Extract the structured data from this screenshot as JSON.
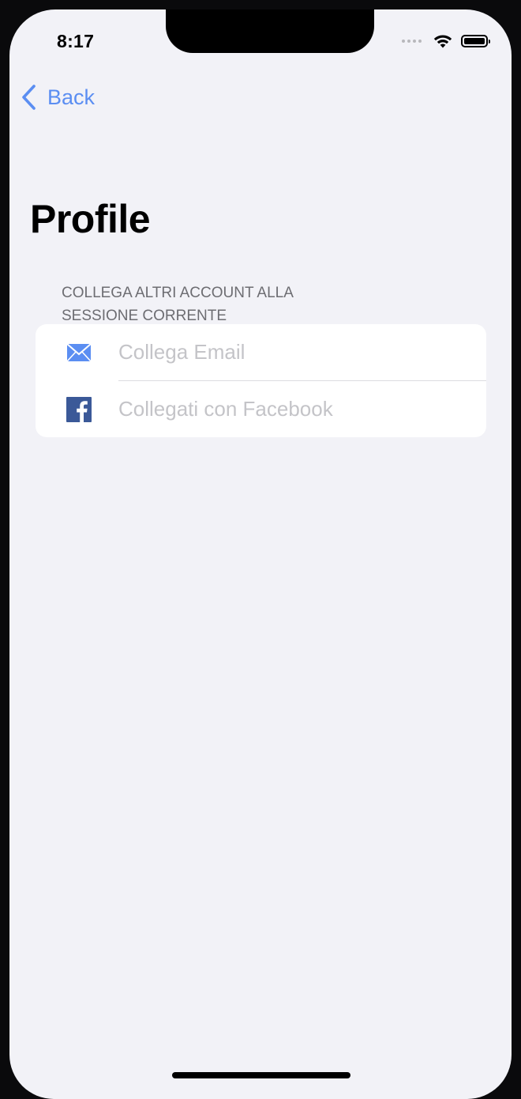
{
  "status_bar": {
    "time": "8:17"
  },
  "nav": {
    "back_label": "Back"
  },
  "page": {
    "title": "Profile"
  },
  "section": {
    "header": "COLLEGA ALTRI ACCOUNT ALLA SESSIONE CORRENTE",
    "rows": [
      {
        "label": "Collega Email",
        "icon": "envelope-icon"
      },
      {
        "label": "Collegati con Facebook",
        "icon": "facebook-icon"
      }
    ]
  },
  "colors": {
    "accent": "#5b8ef2",
    "facebook": "#3b5998",
    "background": "#f2f2f7",
    "placeholder_text": "#c4c4c8"
  }
}
